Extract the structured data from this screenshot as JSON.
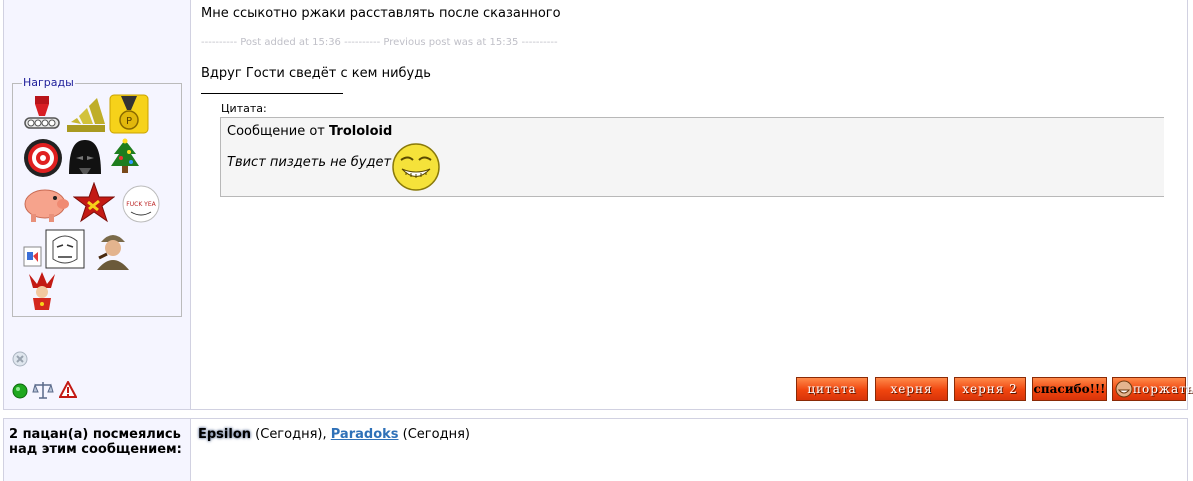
{
  "post": {
    "line1": "Мне ссыкотно ржаки расставлять после сказанного",
    "separator": "---------- Post added at 15:36 ---------- Previous post was at 15:35 ----------",
    "line2": "Вдруг Гости сведёт с кем нибудь",
    "quote": {
      "title": "Цитата:",
      "from_prefix": "Сообщение от ",
      "author": "Trololoid",
      "text": "Твист пиздеть не будет"
    }
  },
  "sidebar": {
    "awards_legend": "Награды"
  },
  "buttons": {
    "quote": "цитата",
    "herya": "херня",
    "herya2": "херня 2",
    "thanks": "спасибо!!!",
    "laugh": "поржать"
  },
  "laughers": {
    "label": "2 пацан(а) посмеялись над этим сообщением:",
    "user1": "Epsilon",
    "user1_when": " (Сегодня), ",
    "user2": "Paradoks",
    "user2_when": " (Сегодня)"
  },
  "colors": {
    "accent_button": "#f0450e",
    "link": "#2f71b8",
    "sidebar_bg": "#f5f5ff",
    "online": "#1fa81f"
  }
}
